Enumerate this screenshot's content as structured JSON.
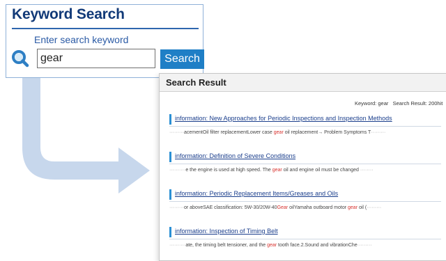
{
  "search": {
    "title": "Keyword Search",
    "label": "Enter search keyword",
    "input_value": "gear",
    "button_label": "Search"
  },
  "result": {
    "title": "Search Result",
    "summary_keyword": "Keyword: gear",
    "summary_count": "Search Result: 200hit",
    "items": [
      {
        "link": "information: New Approaches for Periodic Inspections and Inspection Methods",
        "lead": "·········",
        "before": "acementOil filter replacementLower case ",
        "keyword": "gear",
        "after": " oil replacement→ Problem Symptoms T",
        "trail": "·········"
      },
      {
        "link": "information: Definition of Severe Conditions",
        "lead": "··········",
        "before": "e the engine is used at high speed. The ",
        "keyword": "gear",
        "after": " oil and engine oil must be changed ",
        "trail": "········"
      },
      {
        "link": "information: Periodic Replacement Items/Greases and Oils",
        "lead": "·········",
        "before": "or aboveSAE classification: 5W-30/20W-40",
        "keyword": "Gear",
        "after": " oilYamaha outboard motor ",
        "keyword2": "gear",
        "after2": " oil (",
        "trail": "·········"
      },
      {
        "link": "information: Inspection of Timing Belt",
        "lead": "··········",
        "before": "ate, the timing belt tensioner, and the ",
        "keyword": "gear",
        "after": " tooth face.2.Sound and vibrationChe",
        "trail": "·········"
      }
    ]
  },
  "colors": {
    "title": "#123a78",
    "accent": "#1f7fc6",
    "arrow": "#c7d7ec",
    "highlight": "#d8322e"
  },
  "icons": {
    "search": "magnifier-icon",
    "arrow": "arrow-right-icon"
  }
}
